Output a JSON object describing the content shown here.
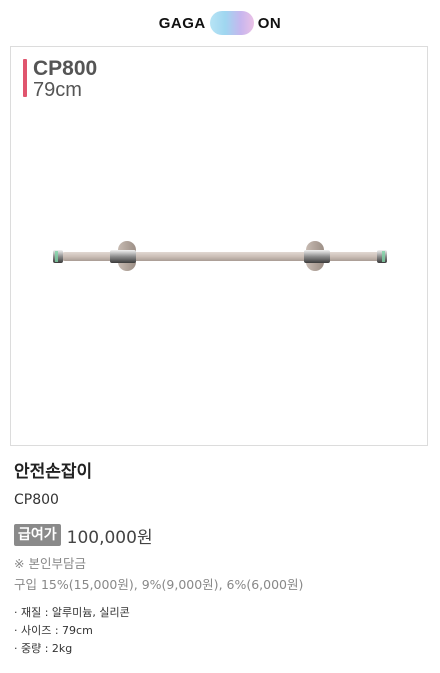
{
  "brand": {
    "left": "GAGA",
    "right": "ON"
  },
  "product_image": {
    "model": "CP800",
    "size": "79cm"
  },
  "product": {
    "name": "안전손잡이",
    "code": "CP800",
    "badge": "급여가",
    "price": "100,000원",
    "note": "※ 본인부담금",
    "copay": "구입 15%(15,000원), 9%(9,000원), 6%(6,000원)",
    "specs": [
      "· 재질 : 알루미늄, 실리콘",
      "· 사이즈 : 79cm",
      "· 중량 : 2kg"
    ]
  },
  "colors": {
    "accent": "#e0556e",
    "badge": "#8a8a8a"
  }
}
